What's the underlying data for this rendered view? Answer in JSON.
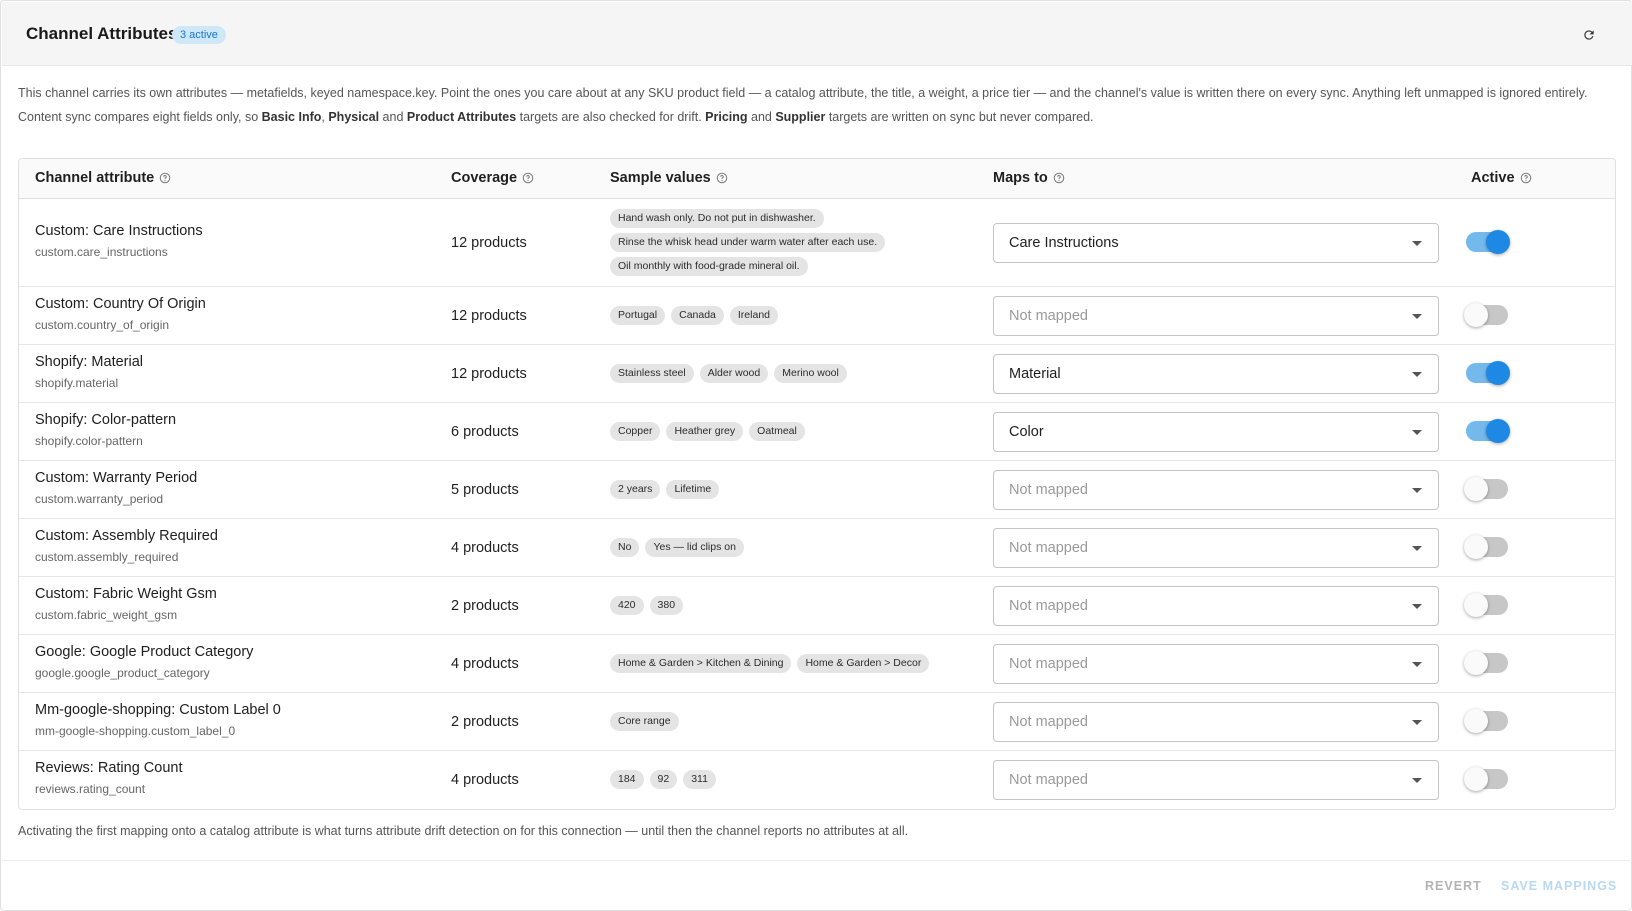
{
  "header": {
    "title": "Channel Attributes",
    "badge": "3 active"
  },
  "intro": {
    "p1": "This channel carries its own attributes — metafields, keyed namespace.key. Point the ones you care about at any SKU product field — a catalog attribute, the title, a weight, a price tier — and the channel's value is written there on every sync. Anything left unmapped is ignored entirely.",
    "p2_a": "Content sync compares eight fields only, so ",
    "p2_b1": "Basic Info",
    "p2_c": ", ",
    "p2_b2": "Physical",
    "p2_d": " and ",
    "p2_b3": "Product Attributes",
    "p2_e": " targets are also checked for drift. ",
    "p2_b4": "Pricing",
    "p2_f": " and ",
    "p2_b5": "Supplier",
    "p2_g": " targets are written on sync but never compared."
  },
  "table": {
    "columns": {
      "attribute": "Channel attribute",
      "coverage": "Coverage",
      "samples": "Sample values",
      "maps_to": "Maps to",
      "active": "Active"
    },
    "rows": [
      {
        "name": "Custom: Care Instructions",
        "key": "custom.care_instructions",
        "coverage": "12 products",
        "samples": [
          "Hand wash only. Do not put in dishwasher.",
          "Rinse the whisk head under warm water after each use.",
          "Oil monthly with food-grade mineral oil."
        ],
        "maps_to": "Care Instructions",
        "mapped": true,
        "active": true
      },
      {
        "name": "Custom: Country Of Origin",
        "key": "custom.country_of_origin",
        "coverage": "12 products",
        "samples": [
          "Portugal",
          "Canada",
          "Ireland"
        ],
        "maps_to": "Not mapped",
        "mapped": false,
        "active": false
      },
      {
        "name": "Shopify: Material",
        "key": "shopify.material",
        "coverage": "12 products",
        "samples": [
          "Stainless steel",
          "Alder wood",
          "Merino wool"
        ],
        "maps_to": "Material",
        "mapped": true,
        "active": true
      },
      {
        "name": "Shopify: Color-pattern",
        "key": "shopify.color-pattern",
        "coverage": "6 products",
        "samples": [
          "Copper",
          "Heather grey",
          "Oatmeal"
        ],
        "maps_to": "Color",
        "mapped": true,
        "active": true
      },
      {
        "name": "Custom: Warranty Period",
        "key": "custom.warranty_period",
        "coverage": "5 products",
        "samples": [
          "2 years",
          "Lifetime"
        ],
        "maps_to": "Not mapped",
        "mapped": false,
        "active": false
      },
      {
        "name": "Custom: Assembly Required",
        "key": "custom.assembly_required",
        "coverage": "4 products",
        "samples": [
          "No",
          "Yes — lid clips on"
        ],
        "maps_to": "Not mapped",
        "mapped": false,
        "active": false
      },
      {
        "name": "Custom: Fabric Weight Gsm",
        "key": "custom.fabric_weight_gsm",
        "coverage": "2 products",
        "samples": [
          "420",
          "380"
        ],
        "maps_to": "Not mapped",
        "mapped": false,
        "active": false
      },
      {
        "name": "Google: Google Product Category",
        "key": "google.google_product_category",
        "coverage": "4 products",
        "samples": [
          "Home & Garden > Kitchen & Dining",
          "Home & Garden > Decor"
        ],
        "maps_to": "Not mapped",
        "mapped": false,
        "active": false
      },
      {
        "name": "Mm-google-shopping: Custom Label 0",
        "key": "mm-google-shopping.custom_label_0",
        "coverage": "2 products",
        "samples": [
          "Core range"
        ],
        "maps_to": "Not mapped",
        "mapped": false,
        "active": false
      },
      {
        "name": "Reviews: Rating Count",
        "key": "reviews.rating_count",
        "coverage": "4 products",
        "samples": [
          "184",
          "92",
          "311"
        ],
        "maps_to": "Not mapped",
        "mapped": false,
        "active": false
      }
    ]
  },
  "footnote": "Activating the first mapping onto a catalog attribute is what turns attribute drift detection on for this connection — until then the channel reports no attributes at all.",
  "footer": {
    "revert": "REVERT",
    "save": "SAVE MAPPINGS"
  },
  "colors": {
    "accent": "#1e88e5",
    "accent_track": "#74b9ec",
    "badge_bg": "#cfe8f8",
    "badge_text": "#1976d2"
  },
  "icons": {
    "refresh": "refresh-icon",
    "help": "help-circle-icon",
    "dropdown": "caret-down-icon"
  }
}
